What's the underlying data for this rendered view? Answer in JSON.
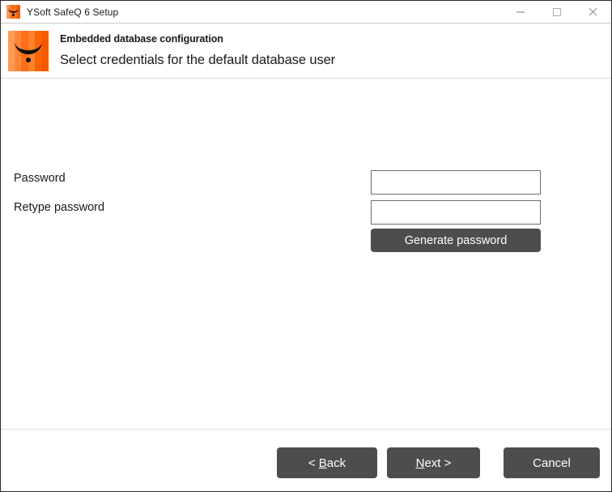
{
  "window": {
    "title": "YSoft SafeQ 6 Setup",
    "app_icon": "ysoft-logo-icon",
    "controls": {
      "minimize": "minimize-icon",
      "maximize": "maximize-icon",
      "close": "close-icon"
    }
  },
  "header": {
    "logo": "ysoft-logo-icon",
    "title": "Embedded database configuration",
    "subtitle": "Select credentials for the default database user"
  },
  "form": {
    "password": {
      "label": "Password",
      "value": "",
      "placeholder": ""
    },
    "retype_password": {
      "label": "Retype password",
      "value": "",
      "placeholder": ""
    },
    "generate_button": "Generate password"
  },
  "footer": {
    "back": {
      "prefix": "< ",
      "accel": "B",
      "rest": "ack"
    },
    "next": {
      "accel": "N",
      "rest": "ext",
      "suffix": " >"
    },
    "cancel": "Cancel"
  },
  "colors": {
    "brand_orange": "#ff6e18",
    "button_gray": "#4d4d4d",
    "input_border": "#6e6e6e",
    "text": "#1a1a1a",
    "window_border": "#2b2b2b"
  }
}
